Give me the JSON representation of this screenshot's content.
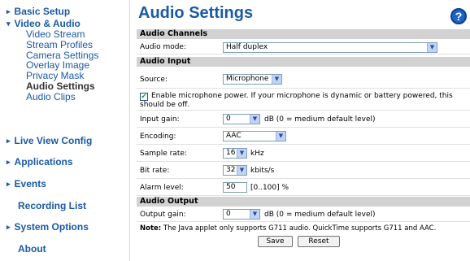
{
  "sidebar": {
    "basic_setup": "Basic Setup",
    "video_audio": "Video & Audio",
    "sub": [
      "Video Stream",
      "Stream Profiles",
      "Camera Settings",
      "Overlay Image",
      "Privacy Mask",
      "Audio Settings",
      "Audio Clips"
    ],
    "live_view": "Live View Config",
    "applications": "Applications",
    "events": "Events",
    "recording_list": "Recording List",
    "system_options": "System Options",
    "about": "About"
  },
  "page": {
    "title": "Audio Settings",
    "help_icon": "?"
  },
  "channels": {
    "header": "Audio Channels",
    "mode_label": "Audio mode:",
    "mode_value": "Half duplex"
  },
  "input": {
    "header": "Audio Input",
    "source_label": "Source:",
    "source_value": "Microphone",
    "power_text": "Enable microphone power. If your microphone is dynamic or battery powered, this should be off.",
    "power_checked": true,
    "gain_label": "Input gain:",
    "gain_value": "0",
    "gain_unit": "dB (0 = medium default level)",
    "encoding_label": "Encoding:",
    "encoding_value": "AAC",
    "rate_label": "Sample rate:",
    "rate_value": "16",
    "rate_unit": "kHz",
    "bitrate_label": "Bit rate:",
    "bitrate_value": "32",
    "bitrate_unit": "kbits/s",
    "alarm_label": "Alarm level:",
    "alarm_value": "50",
    "alarm_unit": "[0..100] %"
  },
  "output": {
    "header": "Audio Output",
    "gain_label": "Output gain:",
    "gain_value": "0",
    "gain_unit": "dB (0 = medium default level)"
  },
  "note": {
    "bold": "Note:",
    "text": " The Java applet only supports G711 audio. QuickTime supports G711 and AAC."
  },
  "buttons": {
    "save": "Save",
    "reset": "Reset"
  },
  "colors": {
    "link": "#1a5aa5",
    "section_bg": "#d2d2d2",
    "help_bg": "#1e63c8"
  },
  "icons": {
    "arrow": "▸",
    "arrow_open": "▾",
    "dropdown": "▼",
    "check": "✔"
  }
}
